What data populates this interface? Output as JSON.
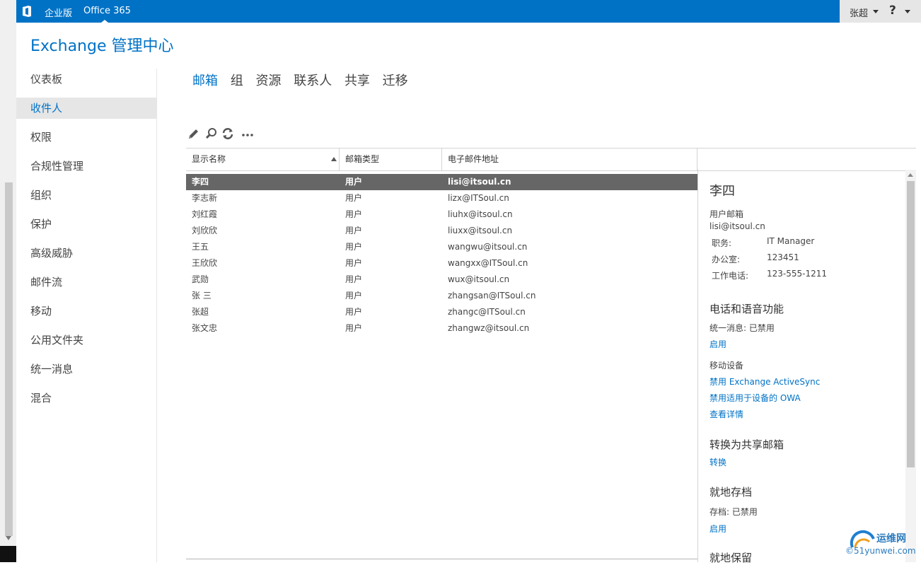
{
  "topbar": {
    "edition": "企业版",
    "product": "Office 365",
    "user": "张超",
    "help": "?"
  },
  "app": {
    "title": "Exchange 管理中心"
  },
  "sidebar": {
    "items": [
      {
        "label": "仪表板"
      },
      {
        "label": "收件人",
        "active": true
      },
      {
        "label": "权限"
      },
      {
        "label": "合规性管理"
      },
      {
        "label": "组织"
      },
      {
        "label": "保护"
      },
      {
        "label": "高级威胁"
      },
      {
        "label": "邮件流"
      },
      {
        "label": "移动"
      },
      {
        "label": "公用文件夹"
      },
      {
        "label": "统一消息"
      },
      {
        "label": "混合"
      }
    ]
  },
  "tabs": [
    {
      "label": "邮箱",
      "active": true
    },
    {
      "label": "组"
    },
    {
      "label": "资源"
    },
    {
      "label": "联系人"
    },
    {
      "label": "共享"
    },
    {
      "label": "迁移"
    }
  ],
  "toolbar": {
    "icons": [
      "edit-icon",
      "search-icon",
      "refresh-icon",
      "more-icon"
    ]
  },
  "table": {
    "headers": [
      "显示名称",
      "邮箱类型",
      "电子邮件地址"
    ],
    "rows": [
      {
        "name": "李四",
        "type": "用户",
        "email": "lisi@itsoul.cn",
        "selected": true
      },
      {
        "name": "李志新",
        "type": "用户",
        "email": "lizx@ITSoul.cn"
      },
      {
        "name": "刘红霞",
        "type": "用户",
        "email": "liuhx@itsoul.cn"
      },
      {
        "name": "刘欣欣",
        "type": "用户",
        "email": "liuxx@itsoul.cn"
      },
      {
        "name": "王五",
        "type": "用户",
        "email": "wangwu@itsoul.cn"
      },
      {
        "name": "王欣欣",
        "type": "用户",
        "email": "wangxx@ITSoul.cn"
      },
      {
        "name": "武勋",
        "type": "用户",
        "email": "wux@itsoul.cn"
      },
      {
        "name": "张 三",
        "type": "用户",
        "email": "zhangsan@ITSoul.cn"
      },
      {
        "name": "张超",
        "type": "用户",
        "email": "zhangc@ITSoul.cn"
      },
      {
        "name": "张文忠",
        "type": "用户",
        "email": "zhangwz@itsoul.cn"
      }
    ]
  },
  "detail": {
    "name": "李四",
    "mailbox_type": "用户邮箱",
    "email": "lisi@itsoul.cn",
    "job_title_label": "职务:",
    "job_title": "IT Manager",
    "office_label": "办公室:",
    "office": "123451",
    "phone_label": "工作电话:",
    "phone": "123-555-1211",
    "phone_voice_heading": "电话和语音功能",
    "um_status": "统一消息:  已禁用",
    "um_enable": "启用",
    "mobile_devices": "移动设备",
    "disable_activesync": "禁用 Exchange ActiveSync",
    "disable_owa": "禁用适用于设备的 OWA",
    "view_details": "查看详情",
    "convert_heading": "转换为共享邮箱",
    "convert_link": "转换",
    "archive_heading": "就地存档",
    "archive_status": "存档:  已禁用",
    "archive_enable": "启用",
    "hold_heading": "就地保留"
  },
  "watermark": {
    "name": "运维网",
    "url": "©51yunwei.com"
  },
  "colors": {
    "accent": "#0072c6",
    "selected_row": "#666666"
  }
}
